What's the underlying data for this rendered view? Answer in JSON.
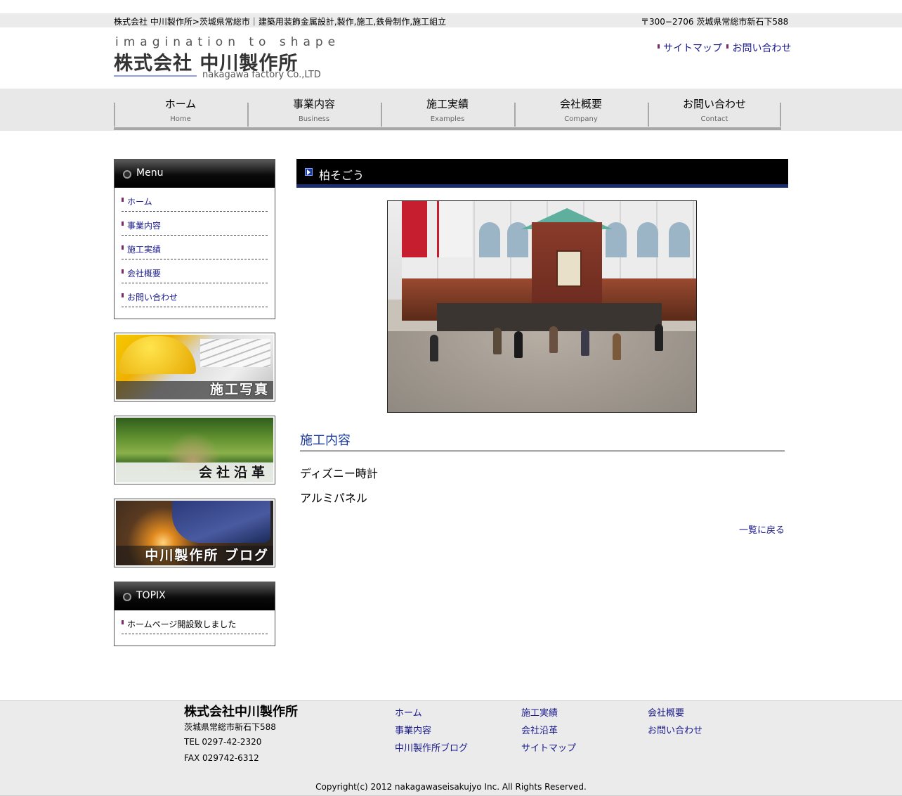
{
  "topbar": {
    "description": "株式会社 中川製作所>茨城県常総市｜建築用装飾金属設計,製作,施工,鉄骨制作,施工組立",
    "address": "〒300−2706 茨城県常総市新石下588"
  },
  "logo": {
    "tagline": "imagination to shape",
    "name": "株式会社 中川製作所",
    "sub": "nakagawa factory Co.,LTD"
  },
  "toplinks": [
    "サイトマップ",
    "お問い合わせ"
  ],
  "gnav": [
    {
      "jp": "ホーム",
      "en": "Home"
    },
    {
      "jp": "事業内容",
      "en": "Business"
    },
    {
      "jp": "施工実績",
      "en": "Examples"
    },
    {
      "jp": "会社概要",
      "en": "Company"
    },
    {
      "jp": "お問い合わせ",
      "en": "Contact"
    }
  ],
  "sidemenu": {
    "title": "Menu",
    "items": [
      "ホーム",
      "事業内容",
      "施工実績",
      "会社概要",
      "お問い合わせ"
    ]
  },
  "banners": [
    "施工写真",
    "会社沿革",
    "中川製作所 ブログ"
  ],
  "topix": {
    "title": "TOPIX",
    "items": [
      "ホームページ開設致しました"
    ]
  },
  "main": {
    "title": "柏そごう",
    "section_heading": "施工内容",
    "lines": [
      "ディズニー時計",
      "アルミパネル"
    ],
    "back_link": "一覧に戻る"
  },
  "footer": {
    "company": "株式会社中川製作所",
    "address": "茨城県常総市新石下588",
    "tel": "TEL 0297-42-2320",
    "fax": "FAX 029742-6312",
    "links": [
      [
        "ホーム",
        "事業内容",
        "中川製作所ブログ"
      ],
      [
        "施工実績",
        "会社沿革",
        "サイトマップ"
      ],
      [
        "会社概要",
        "お問い合わせ"
      ]
    ],
    "copyright": "Copyright(c) 2012 nakagawaseisakujyo Inc. All Rights Reserved."
  },
  "colors": {
    "link": "#1a1a8c",
    "heading_blue": "#1a3aa0",
    "title_bar": "#000000",
    "title_bar_underline": "#1c2a6e",
    "bullet": "#7a2a6a",
    "nav_bg": "#e8e8e8"
  }
}
